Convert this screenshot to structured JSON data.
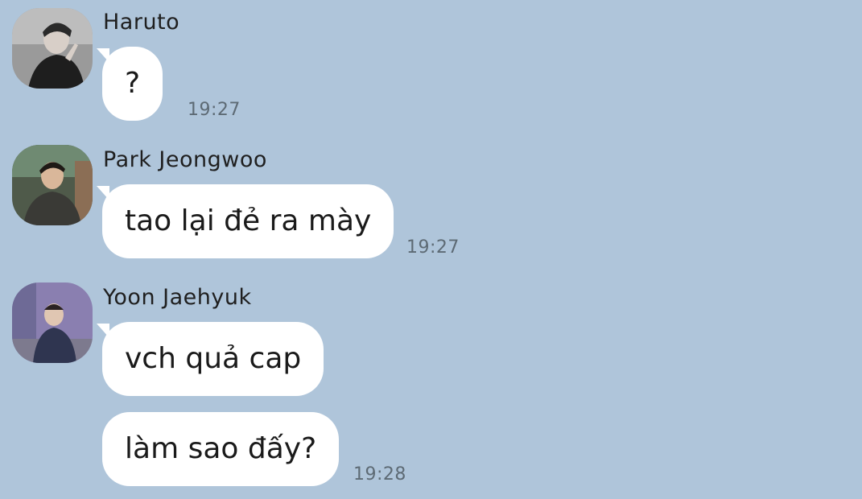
{
  "chat": {
    "messages": [
      {
        "sender": "Haruto",
        "avatar": "avatar-haruto",
        "bubbles": [
          "?"
        ],
        "time": "19:27"
      },
      {
        "sender": "Park Jeongwoo",
        "avatar": "avatar-park-jeongwoo",
        "bubbles": [
          "tao lại đẻ ra mày"
        ],
        "time": "19:27"
      },
      {
        "sender": "Yoon Jaehyuk",
        "avatar": "avatar-yoon-jaehyuk",
        "bubbles": [
          "vch quả cap",
          "làm sao đấy?"
        ],
        "time": "19:28"
      }
    ]
  },
  "colors": {
    "background": "#afc5da",
    "bubble": "#ffffff",
    "time_text": "#5d6a74"
  }
}
